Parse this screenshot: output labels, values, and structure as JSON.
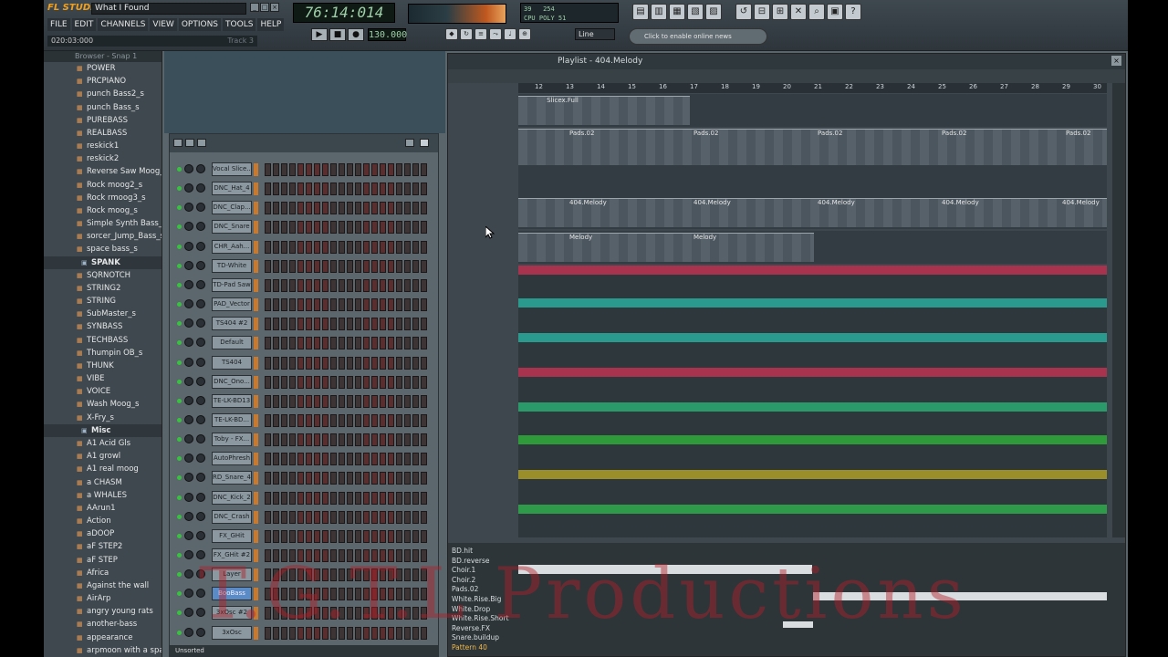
{
  "window": {
    "logo": "FL STUDIO",
    "song_title": "What I Found"
  },
  "menu": [
    "FILE",
    "EDIT",
    "CHANNELS",
    "VIEW",
    "OPTIONS",
    "TOOLS",
    "HELP"
  ],
  "hint": {
    "time": "020:03:000",
    "track": "Track 3"
  },
  "transport": {
    "time_display": "76:14:014",
    "tempo": "130.000",
    "snap": "Line"
  },
  "news": "Click to enable online news",
  "browser": {
    "header": "Browser - Snap 1",
    "items": [
      {
        "label": "POWER"
      },
      {
        "label": "PRCPIANO"
      },
      {
        "label": "punch Bass2_s"
      },
      {
        "label": "punch Bass_s"
      },
      {
        "label": "PUREBASS"
      },
      {
        "label": "REALBASS"
      },
      {
        "label": "reskick1"
      },
      {
        "label": "reskick2"
      },
      {
        "label": "Reverse Saw Moog_s"
      },
      {
        "label": "Rock moog2_s"
      },
      {
        "label": "Rock rmoog3_s"
      },
      {
        "label": "Rock moog_s"
      },
      {
        "label": "Simple Synth Bass_s"
      },
      {
        "label": "sorcer_Jump_Bass_s"
      },
      {
        "label": "space bass_s"
      },
      {
        "label": "SPANK",
        "folder": true
      },
      {
        "label": "SQRNOTCH"
      },
      {
        "label": "STRING2"
      },
      {
        "label": "STRING"
      },
      {
        "label": "SubMaster_s"
      },
      {
        "label": "SYNBASS"
      },
      {
        "label": "TECHBASS"
      },
      {
        "label": "Thumpin OB_s"
      },
      {
        "label": "THUNK"
      },
      {
        "label": "VIBE"
      },
      {
        "label": "VOICE"
      },
      {
        "label": "Wash Moog_s"
      },
      {
        "label": "X-Fry_s"
      },
      {
        "label": "Misc",
        "folder": true
      },
      {
        "label": "A1 Acid Gls"
      },
      {
        "label": "A1 growl"
      },
      {
        "label": "A1 real moog"
      },
      {
        "label": "a CHASM"
      },
      {
        "label": "a WHALES"
      },
      {
        "label": "AArun1"
      },
      {
        "label": "Action"
      },
      {
        "label": "aDOOP"
      },
      {
        "label": "aF STEP2"
      },
      {
        "label": "aF STEP"
      },
      {
        "label": "Africa"
      },
      {
        "label": "Against the wall"
      },
      {
        "label": "AirArp"
      },
      {
        "label": "angry young rats"
      },
      {
        "label": "another-bass"
      },
      {
        "label": "appearance"
      },
      {
        "label": "arpmoon with a spare"
      }
    ]
  },
  "channels": [
    {
      "name": "Vocal Slice..."
    },
    {
      "name": "DNC_Hat_4"
    },
    {
      "name": "DNC_Clap..."
    },
    {
      "name": "DNC_Snare"
    },
    {
      "name": "CHR_Aah..."
    },
    {
      "name": "TD-White"
    },
    {
      "name": "TD-Pad Saw"
    },
    {
      "name": "PAD_Vector"
    },
    {
      "name": "TS404 #2"
    },
    {
      "name": "Default"
    },
    {
      "name": "TS404"
    },
    {
      "name": "DNC_Ono..."
    },
    {
      "name": "TE-LK-BD13"
    },
    {
      "name": "TE-LK-BD..."
    },
    {
      "name": "Toby - FX..."
    },
    {
      "name": "AutoPhresh"
    },
    {
      "name": "RD_Snare_4"
    },
    {
      "name": "DNC_Kick_2"
    },
    {
      "name": "DNC_Crash"
    },
    {
      "name": "FX_GHit"
    },
    {
      "name": "FX_GHit #2"
    },
    {
      "name": "Layer"
    },
    {
      "name": "BooBass",
      "selected": true
    },
    {
      "name": "3xOsc #2"
    },
    {
      "name": "3xOsc"
    }
  ],
  "rack_footer": "Unsorted",
  "playlist": {
    "title": "Playlist - 404.Melody",
    "ruler": [
      "12",
      "13",
      "14",
      "15",
      "16",
      "17",
      "18",
      "19",
      "20",
      "21",
      "22",
      "23",
      "24",
      "25",
      "26",
      "27",
      "28",
      "29",
      "30"
    ],
    "clips": {
      "slices": "Slicex.Full",
      "pads": "Pads.02",
      "melody404": "404.Melody",
      "melody": "Melody"
    },
    "lower_tracks": [
      "BD.hit",
      "BD.reverse",
      "Choir.1",
      "Choir.2",
      "Pads.02",
      "White.Rise.Big",
      "White.Drop",
      "White.Rise.Short",
      "Reverse.FX",
      "Snare.buildup",
      "Pattern 40"
    ]
  },
  "watermark": "T.G.T.L Productions"
}
